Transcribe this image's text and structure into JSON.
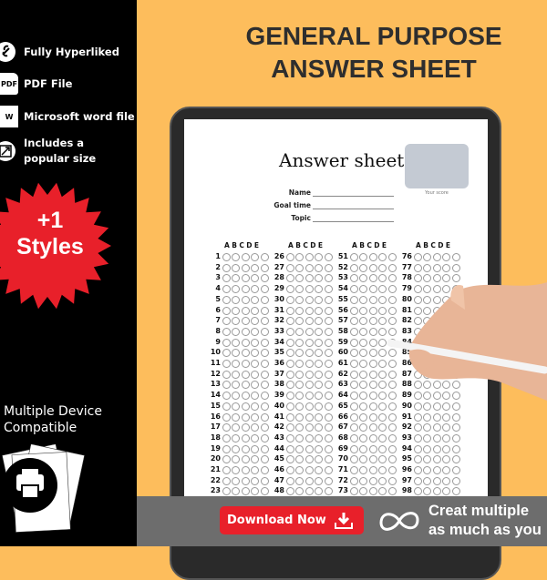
{
  "features": [
    {
      "icon": "link-icon",
      "label": "Fully Hyperliked"
    },
    {
      "icon": "pdf-file-icon",
      "icon_text": "PDF",
      "label": "PDF File"
    },
    {
      "icon": "word-file-icon",
      "icon_text": "W",
      "label": "Microsoft word file"
    },
    {
      "icon": "resize-icon",
      "label_line1": "Includes a",
      "label_line2": "popular size"
    }
  ],
  "badge": {
    "line1": "+1",
    "line2": "Styles",
    "color": "#e8202a"
  },
  "devices": {
    "line1": "Multiple Device",
    "line2": "Compatible"
  },
  "title": {
    "line1": "GENERAL PURPOSE",
    "line2": "ANSWER SHEET"
  },
  "sheet": {
    "title": "Answer sheet",
    "score_label": "Your score",
    "fields": [
      "Name",
      "Goal time",
      "Topic"
    ],
    "choices": "ABCDE",
    "columns": [
      [
        1,
        2,
        3,
        4,
        5,
        6,
        7,
        8,
        9,
        10,
        11,
        12,
        13,
        14,
        15,
        16,
        17,
        18,
        19,
        20,
        21,
        22,
        23
      ],
      [
        26,
        27,
        28,
        29,
        30,
        31,
        32,
        33,
        34,
        35,
        36,
        37,
        38,
        39,
        40,
        41,
        42,
        43,
        44,
        45,
        46,
        47,
        48
      ],
      [
        51,
        52,
        53,
        54,
        55,
        56,
        57,
        58,
        59,
        60,
        61,
        62,
        63,
        64,
        65,
        66,
        67,
        68,
        69,
        70,
        71,
        72,
        73
      ],
      [
        76,
        77,
        78,
        79,
        80,
        81,
        82,
        83,
        84,
        85,
        86,
        87,
        88,
        89,
        90,
        91,
        92,
        93,
        94,
        95,
        96,
        97,
        98
      ]
    ]
  },
  "footer": {
    "download_label": "Download Now",
    "promo_line1": "Creat multiple",
    "promo_line2": "as much as you"
  },
  "colors": {
    "background": "#fdbd5c",
    "accent": "#e8202a",
    "footer": "#6d6d6d"
  }
}
